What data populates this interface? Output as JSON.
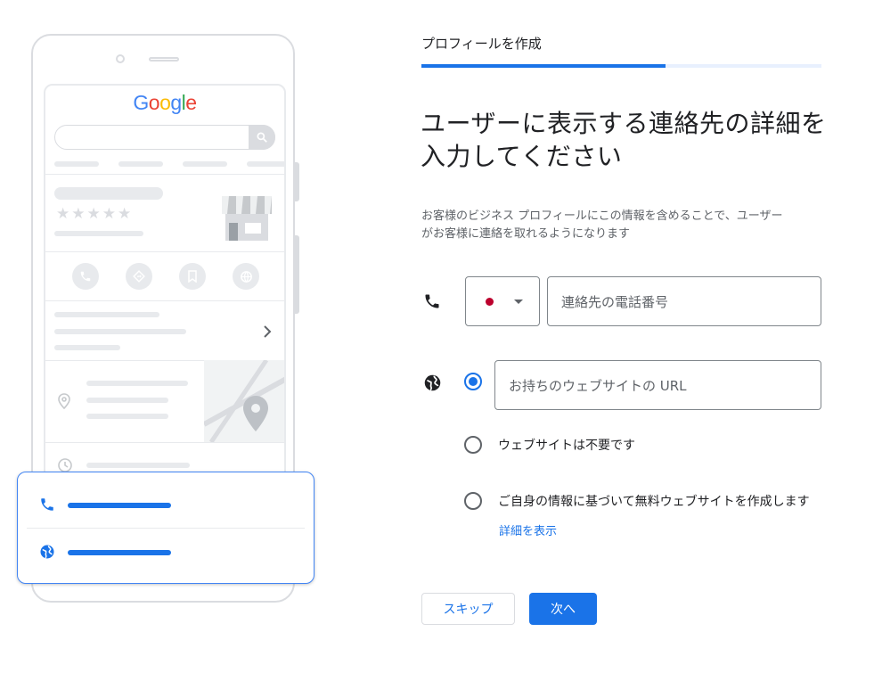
{
  "illustration": {
    "logo_letters": [
      "G",
      "o",
      "o",
      "g",
      "l",
      "e"
    ],
    "stars": "★★★★★",
    "icons": {
      "search": "search-icon",
      "phone": "phone-icon",
      "directions": "directions-icon",
      "bookmark": "bookmark-icon",
      "globe": "globe-icon",
      "store": "store-icon",
      "location": "location-pin-icon",
      "clock": "clock-icon",
      "chevron": "chevron-right-icon"
    }
  },
  "header": {
    "step_label": "プロフィールを作成",
    "progress": 0.61
  },
  "main": {
    "title_line1": "ユーザーに表示する連絡先の詳細を",
    "title_line2": "入力してください",
    "description_line1": "お客様のビジネス プロフィールにこの情報を含めることで、ユーザー",
    "description_line2": "がお客様に連絡を取れるようになります"
  },
  "phone": {
    "placeholder": "連絡先の電話番号",
    "country_flag": "JP"
  },
  "website": {
    "input_placeholder": "お持ちのウェブサイトの URL",
    "option_no_site": "ウェブサイトは不要です",
    "option_free_site": "ご自身の情報に基づいて無料ウェブサイトを作成します",
    "details_link": "詳細を表示",
    "selected_option": "url"
  },
  "actions": {
    "skip_label": "スキップ",
    "next_label": "次へ"
  },
  "colors": {
    "accent": "#1a73e8",
    "flag_red": "#bc002d",
    "gray_line": "#e8eaed"
  }
}
